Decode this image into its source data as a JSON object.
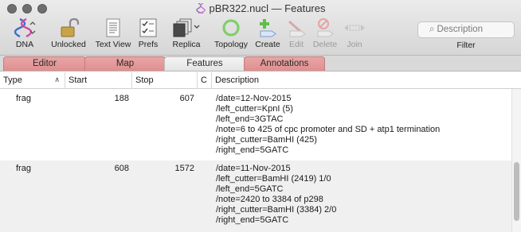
{
  "window": {
    "title": "pBR322.nucl — Features"
  },
  "toolbar": {
    "dna": "DNA",
    "unlocked": "Unlocked",
    "text_view": "Text View",
    "prefs": "Prefs",
    "replica": "Replica",
    "topology": "Topology",
    "create": "Create",
    "edit": "Edit",
    "delete": "Delete",
    "join": "Join",
    "search_placeholder": "Description",
    "filter": "Filter"
  },
  "tabs": [
    "Editor",
    "Map",
    "Features",
    "Annotations"
  ],
  "active_tab": "Features",
  "columns": {
    "type": "Type",
    "start": "Start",
    "stop": "Stop",
    "c": "C",
    "description": "Description"
  },
  "rows": [
    {
      "type": "frag",
      "start": "188",
      "stop": "607",
      "description": [
        "/date=12-Nov-2015",
        "/left_cutter=KpnI (5)",
        "/left_end=3GTAC",
        "/note=6 to 425 of cpc promoter and SD + atp1 termination",
        "/right_cutter=BamHI (425)",
        "/right_end=5GATC"
      ]
    },
    {
      "type": "frag",
      "start": "608",
      "stop": "1572",
      "description": [
        "/date=11-Nov-2015",
        "/left_cutter=BamHI (2419) 1/0",
        "/left_end=5GATC",
        "/note=2420 to 3384 of p298",
        "/right_cutter=BamHI (3384) 2/0",
        "/right_end=5GATC"
      ]
    }
  ],
  "colors": {
    "tab_inactive": "#e59a9a",
    "tab_active": "#ececec",
    "row_alt": "#f0f0f0"
  }
}
